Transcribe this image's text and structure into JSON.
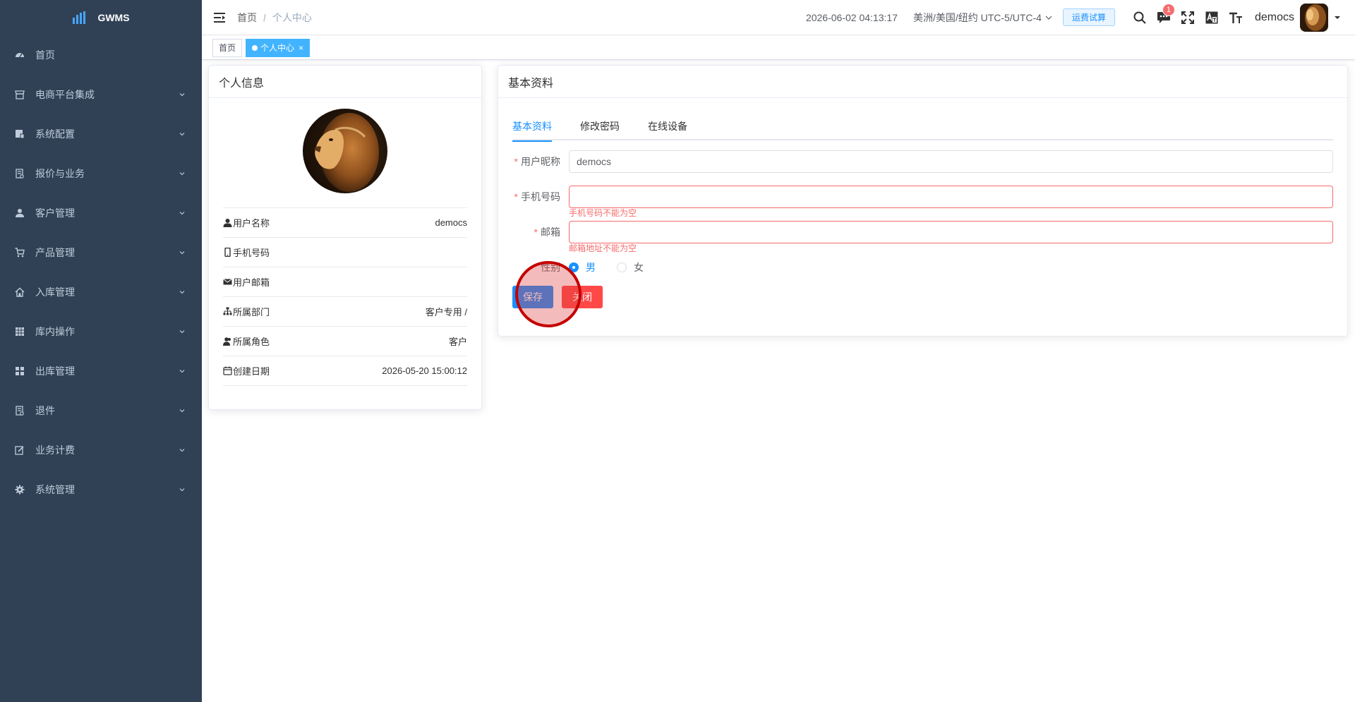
{
  "app": {
    "logo_text": "GWMS",
    "sidebar_bg": "#304156",
    "accent": "#1890ff"
  },
  "sidebar": {
    "items": [
      {
        "label": "首页",
        "icon": "dashboard-icon",
        "has_children": false
      },
      {
        "label": "电商平台集成",
        "icon": "store-icon",
        "has_children": true
      },
      {
        "label": "系统配置",
        "icon": "config-icon",
        "has_children": true
      },
      {
        "label": "报价与业务",
        "icon": "document-icon",
        "has_children": true
      },
      {
        "label": "客户管理",
        "icon": "user-icon",
        "has_children": true
      },
      {
        "label": "产品管理",
        "icon": "cart-icon",
        "has_children": true
      },
      {
        "label": "入库管理",
        "icon": "home-icon",
        "has_children": true
      },
      {
        "label": "库内操作",
        "icon": "table-icon",
        "has_children": true
      },
      {
        "label": "出库管理",
        "icon": "grid-icon",
        "has_children": true
      },
      {
        "label": "退件",
        "icon": "return-icon",
        "has_children": true
      },
      {
        "label": "业务计费",
        "icon": "edit-icon",
        "has_children": true
      },
      {
        "label": "系统管理",
        "icon": "gear-icon",
        "has_children": true
      }
    ]
  },
  "header": {
    "breadcrumb": [
      "首页",
      "个人中心"
    ],
    "datetime": "2026-06-02 04:13:17",
    "timezone": "美洲/美国/纽约 UTC-5/UTC-4",
    "trial_button": "运费试算",
    "notification_count": "1",
    "username": "democs"
  },
  "tags": [
    {
      "label": "首页",
      "active": false
    },
    {
      "label": "个人中心",
      "active": true,
      "close": "×"
    }
  ],
  "profile": {
    "title": "个人信息",
    "rows": [
      {
        "label": "用户名称",
        "value": "democs"
      },
      {
        "label": "手机号码",
        "value": ""
      },
      {
        "label": "用户邮箱",
        "value": ""
      },
      {
        "label": "所属部门",
        "value": "客户专用 /"
      },
      {
        "label": "所属角色",
        "value": "客户"
      },
      {
        "label": "创建日期",
        "value": "2026-05-20 15:00:12"
      }
    ]
  },
  "form_card": {
    "title": "基本资料",
    "tabs": [
      "基本资料",
      "修改密码",
      "在线设备"
    ],
    "active_tab": 0,
    "fields": {
      "nickname": {
        "label": "用户昵称",
        "value": "democs"
      },
      "phone": {
        "label": "手机号码",
        "value": "",
        "error": "手机号码不能为空"
      },
      "email": {
        "label": "邮箱",
        "value": "",
        "error": "邮箱地址不能为空"
      },
      "gender": {
        "label": "性别",
        "options": [
          "男",
          "女"
        ],
        "selected": "男"
      }
    },
    "save_label": "保存",
    "close_label": "关闭"
  }
}
